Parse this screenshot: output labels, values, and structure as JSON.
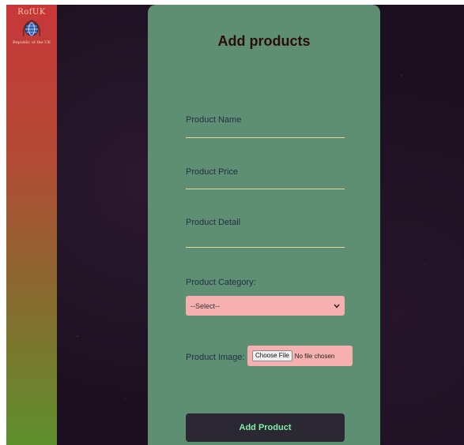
{
  "logo": {
    "title": "RofUK",
    "subtitle": "Republic of the UK",
    "icon": "globe-icon"
  },
  "form": {
    "title": "Add products",
    "product_name_label": "Product Name",
    "product_price_label": "Product Price",
    "product_detail_label": "Product Detail",
    "product_category_label": "Product Category:",
    "category_selected": "--Select--",
    "product_image_label": "Product Image:",
    "file_button_label": "Choose File",
    "file_status": "No file chosen",
    "submit_label": "Add Product"
  },
  "colors": {
    "panel": "#5f8f72",
    "sidebar_top": "#c8373a",
    "sidebar_bottom": "#5e8f2d",
    "select_bg": "#f7b0b0",
    "button_bg": "#2b2733",
    "button_text": "#7ff0a8",
    "underline": "#e8d79a"
  }
}
